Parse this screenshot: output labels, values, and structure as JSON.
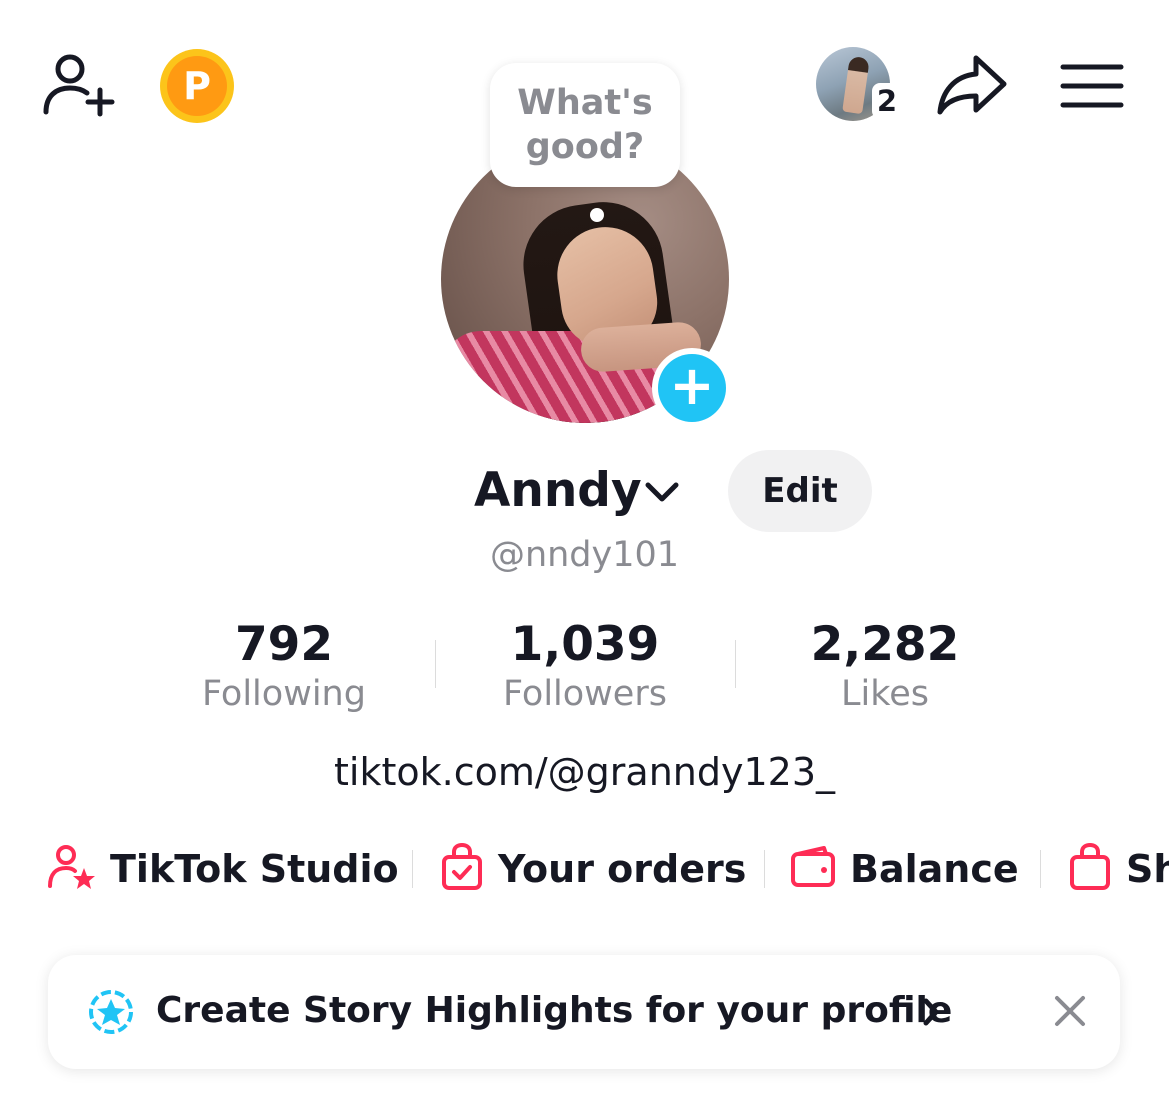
{
  "top_bar": {
    "coin_letter": "P",
    "visitor_count": "2"
  },
  "avatar": {
    "bubble_text": "What's good?"
  },
  "profile": {
    "display_name": "Anndy",
    "username": "@nndy101",
    "edit_label": "Edit",
    "bio_link": "tiktok.com/@granndy123_"
  },
  "stats": [
    {
      "value": "792",
      "label": "Following"
    },
    {
      "value": "1,039",
      "label": "Followers"
    },
    {
      "value": "2,282",
      "label": "Likes"
    }
  ],
  "quick_links": [
    {
      "label": "TikTok Studio",
      "icon": "person-star-icon"
    },
    {
      "label": "Your orders",
      "icon": "bag-check-icon"
    },
    {
      "label": "Balance",
      "icon": "wallet-icon"
    },
    {
      "label": "Sh",
      "icon": "shopping-bag-icon"
    }
  ],
  "banner": {
    "text": "Create Story Highlights for your profile",
    "icon": "story-star-icon"
  },
  "colors": {
    "accent_pink": "#fe2c55",
    "accent_blue": "#20c4f5",
    "coin_orange": "#ff9a12",
    "secondary_text": "#8a8b91"
  }
}
